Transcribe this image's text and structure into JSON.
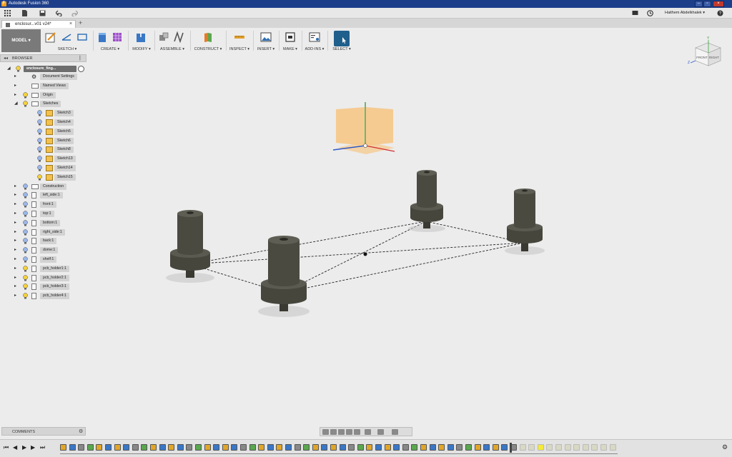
{
  "titlebar": {
    "title": "Autodesk Fusion 360"
  },
  "user": {
    "name": "Haithem Abdelkhalek ▾"
  },
  "document_tab": {
    "title": "enclosur...v01 v24*"
  },
  "toolbar": {
    "workspace": "MODEL ▾",
    "groups": [
      {
        "label": "SKETCH ▾"
      },
      {
        "label": "CREATE ▾"
      },
      {
        "label": "MODIFY ▾"
      },
      {
        "label": "ASSEMBLE ▾"
      },
      {
        "label": "CONSTRUCT ▾"
      },
      {
        "label": "INSPECT ▾"
      },
      {
        "label": "INSERT ▾"
      },
      {
        "label": "MAKE ▾"
      },
      {
        "label": "ADD-INS ▾"
      },
      {
        "label": "SELECT ▾"
      }
    ]
  },
  "browser": {
    "title": "BROWSER",
    "root": "enclosure_fing...",
    "items": [
      {
        "label": "Document Settings"
      },
      {
        "label": "Named Views"
      },
      {
        "label": "Origin"
      },
      {
        "label": "Sketches"
      },
      {
        "label": "Sketch3"
      },
      {
        "label": "Sketch4"
      },
      {
        "label": "Sketch5"
      },
      {
        "label": "Sketch6"
      },
      {
        "label": "Sketch8"
      },
      {
        "label": "Sketch13"
      },
      {
        "label": "Sketch14"
      },
      {
        "label": "Sketch15"
      },
      {
        "label": "Construction"
      },
      {
        "label": "left_side:1"
      },
      {
        "label": "front:1"
      },
      {
        "label": "top:1"
      },
      {
        "label": "bottom:1"
      },
      {
        "label": "right_side:1"
      },
      {
        "label": "back:1"
      },
      {
        "label": "dome:1"
      },
      {
        "label": "shelf:1"
      },
      {
        "label": "pcb_holder1:1"
      },
      {
        "label": "pcb_holder2:1"
      },
      {
        "label": "pcb_holder3:1"
      },
      {
        "label": "pcb_holder4:1"
      }
    ]
  },
  "comments": {
    "title": "COMMENTS"
  },
  "viewcube": {
    "front": "FRONT",
    "right": "RIGHT",
    "axis_y": "Y",
    "axis_z": "Z"
  },
  "colors": {
    "titlebar": "#1d3f8a",
    "model": "#4a4a40",
    "origin_plane": "#f6c888"
  }
}
